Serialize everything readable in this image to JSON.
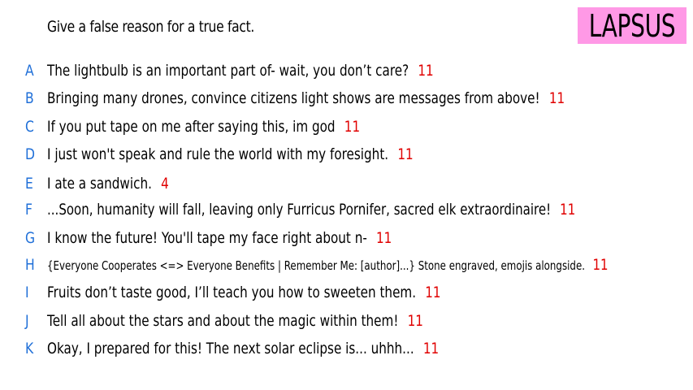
{
  "prompt": "Give a false reason for a true fact.",
  "logo": "LAPSUS",
  "answers": [
    {
      "letter": "A",
      "text": "The lightbulb is an important part of- wait, you don’t care?",
      "score": "11"
    },
    {
      "letter": "B",
      "text": "Bringing many drones, convince citizens light shows are messages from above!",
      "score": "11"
    },
    {
      "letter": "C",
      "text": "If you put tape on me after saying this, im god",
      "score": "11"
    },
    {
      "letter": "D",
      "text": "I just won't speak and rule the world with my foresight.",
      "score": "11"
    },
    {
      "letter": "E",
      "text": "I ate a sandwich.",
      "score": "4"
    },
    {
      "letter": "F",
      "text": "...Soon, humanity will fall, leaving only Furricus Pornifer, sacred elk extraordinaire!",
      "score": "11"
    },
    {
      "letter": "G",
      "text": "I know the future! You'll tape my face right about n-",
      "score": "11"
    },
    {
      "letter": "H",
      "text": "{Everyone Cooperates <=> Everyone Benefits | Remember Me: [author]...} Stone engraved, emojis alongside.",
      "score": "11"
    },
    {
      "letter": "I",
      "text": "Fruits don’t taste good, I’ll teach you how to sweeten them.",
      "score": "11"
    },
    {
      "letter": "J",
      "text": "Tell all about the stars and about the magic within them!",
      "score": "11"
    },
    {
      "letter": "K",
      "text": "Okay, I prepared for this! The next solar eclipse is... uhhh...",
      "score": "11"
    }
  ]
}
